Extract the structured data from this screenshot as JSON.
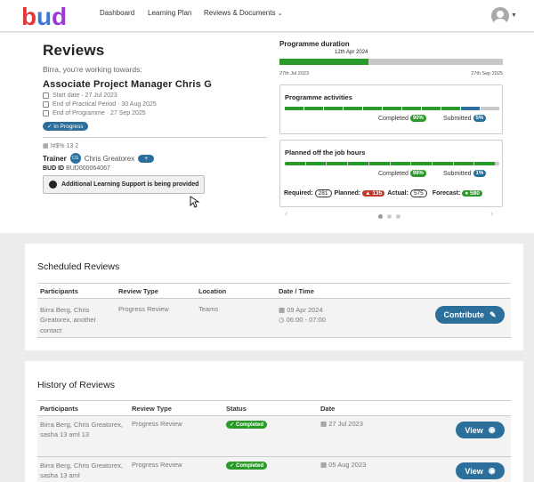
{
  "nav": {
    "logo_text": "bud",
    "links": [
      "Dashboard",
      "Learning Plan",
      "Reviews & Documents"
    ]
  },
  "page": {
    "title": "Reviews",
    "working_towards": "Birra, you're working towards:",
    "qualification": "Associate Project Manager Chris G",
    "start_date": "Start date · 27 Jul 2023",
    "end_practical": "End of Practical Period · 30 Aug 2025",
    "end_programme": "End of Programme · 27 Sep 2025",
    "status": "In Progress",
    "code": "!#$% 13 2",
    "trainer_label": "Trainer",
    "trainer_initials": "CG",
    "trainer_name": "Chris Greatorex",
    "add_label": "+",
    "bud_id_label": "BUD ID",
    "bud_id": "BUD000064067",
    "support_notice": "Additional Learning Support is being provided"
  },
  "duration": {
    "title": "Programme duration",
    "marker": "12th Apr 2024",
    "start": "27th Jul 2023",
    "end": "27th Sep 2025",
    "progress": 0.4
  },
  "activities": {
    "title": "Programme activities",
    "completed_label": "Completed",
    "completed_value": "90%",
    "submitted_label": "Submitted",
    "submitted_value": "5%"
  },
  "otj": {
    "title": "Planned off the job hours",
    "completed_label": "Completed",
    "completed_value": "98%",
    "submitted_label": "Submitted",
    "submitted_value": "1%",
    "progress": 0.98,
    "required_label": "Required:",
    "required": "281",
    "planned_label": "Planned:",
    "planned": "135",
    "actual_label": "Actual:",
    "actual": "575",
    "forecast_label": "Forecast:",
    "forecast": "580"
  },
  "scheduled": {
    "heading": "Scheduled Reviews",
    "columns": [
      "Participants",
      "Review Type",
      "Location",
      "Date / Time"
    ],
    "row": {
      "participants": "Birra Berg, Chris Greatorex, another contact",
      "type": "Progress Review",
      "location": "Teams",
      "date": "09 Apr 2024",
      "time": "06:00 - 07:00"
    },
    "action": "Contribute"
  },
  "history": {
    "heading": "History of Reviews",
    "columns": [
      "Participants",
      "Review Type",
      "Status",
      "Date"
    ],
    "rows": [
      {
        "participants": "Birra Berg, Chris Greatorex, sasha 13 aml 13",
        "type": "Progress Review",
        "status": "Completed",
        "date": "27 Jul 2023"
      },
      {
        "participants": "Birra Berg, Chris Greatorex, sasha 13 aml",
        "type": "Progress Review",
        "status": "Completed",
        "date": "05 Aug 2023"
      }
    ],
    "action": "View"
  },
  "colors": {
    "primary": "#2c6f9b",
    "green": "#2a9a2a",
    "red": "#c0392b"
  }
}
